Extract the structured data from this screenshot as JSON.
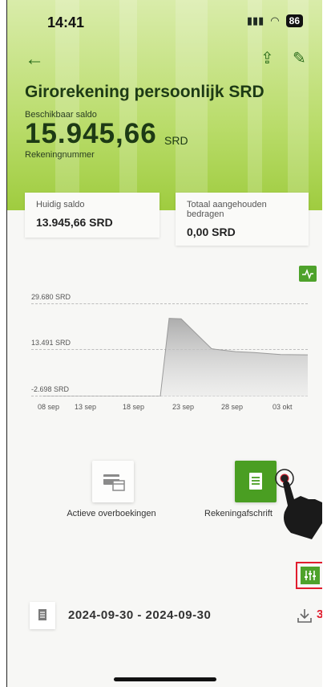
{
  "status_bar": {
    "time": "14:41",
    "battery": "86"
  },
  "account": {
    "name": "Girorekening persoonlijk SRD",
    "available_label": "Beschikbaar saldo",
    "balance": "15.945,66",
    "currency": "SRD",
    "account_number_label": "Rekeningnummer"
  },
  "cards": [
    {
      "label": "Huidig saldo",
      "value": "13.945,66 SRD"
    },
    {
      "label": "Totaal aangehouden bedragen",
      "value": "0,00 SRD"
    }
  ],
  "chart_data": {
    "type": "area",
    "y_ticks": [
      "29.680 SRD",
      "13.491 SRD",
      "-2.698 SRD"
    ],
    "x_ticks": [
      "08 sep",
      "13 sep",
      "18 sep",
      "23 sep",
      "28 sep",
      "03 okt"
    ],
    "ylim": [
      -2698,
      29680
    ],
    "x": [
      "08 sep",
      "13 sep",
      "18 sep",
      "21 sep",
      "22 sep",
      "23 sep",
      "24 sep",
      "25 sep",
      "28 sep",
      "30 sep",
      "03 okt",
      "05 okt"
    ],
    "values": [
      -2698,
      -2698,
      -2698,
      -2698,
      24500,
      24300,
      13900,
      13700,
      12900,
      12600,
      11900,
      11800
    ],
    "grid": true
  },
  "quick_actions": [
    {
      "label": "Actieve overboekingen"
    },
    {
      "label": "Rekeningafschrift"
    }
  ],
  "statement": {
    "period": "2024-09-30 - 2024-09-30",
    "trailing": "3"
  },
  "colors": {
    "brand_green": "#4ea22b",
    "highlight": "#e11d2e"
  }
}
